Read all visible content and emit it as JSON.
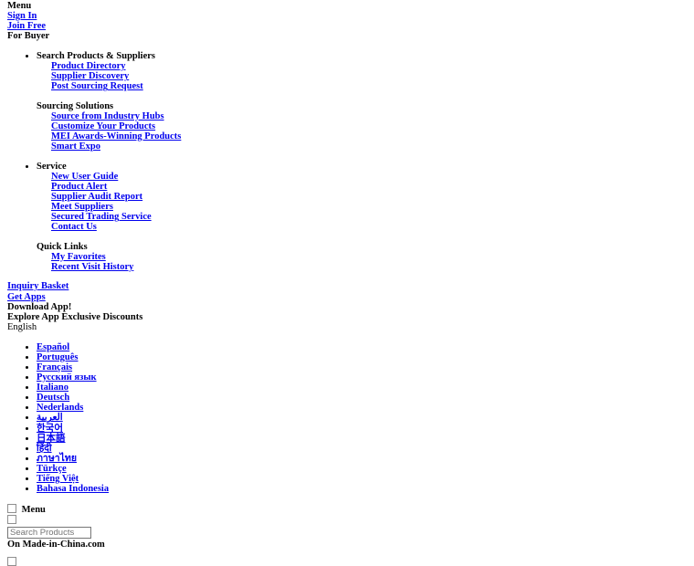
{
  "top": {
    "menu_label": "Menu",
    "sign_in": "Sign In",
    "join_free": "Join Free",
    "for_buyer": "For Buyer"
  },
  "nav": {
    "groups": [
      {
        "title": "Search Products & Suppliers",
        "bulleted": true,
        "links": [
          "Product Directory",
          "Supplier Discovery",
          "Post Sourcing Request"
        ]
      },
      {
        "title": "Sourcing Solutions",
        "bulleted": false,
        "links": [
          "Source from Industry Hubs",
          "Customize Your Products",
          "MEI Awards-Winning Products",
          "Smart Expo"
        ]
      },
      {
        "title": "Service",
        "bulleted": true,
        "links": [
          "New User Guide",
          "Product Alert",
          "Supplier Audit Report",
          "Meet Suppliers",
          "Secured Trading Service",
          "Contact Us"
        ]
      },
      {
        "title": "Quick Links",
        "bulleted": false,
        "links": [
          "My Favorites",
          "Recent Visit History"
        ]
      }
    ]
  },
  "utility": {
    "inquiry_basket": "Inquiry Basket",
    "get_apps": "Get Apps",
    "download_app": "Download App!",
    "explore_discounts": "Explore App Exclusive Discounts",
    "current_language": "English"
  },
  "languages": [
    "Español",
    "Português",
    "Français",
    "Русский язык",
    "Italiano",
    "Deutsch",
    "Nederlands",
    "العربية",
    "한국어",
    "日本語",
    "हिंदी",
    "ภาษาไทย",
    "Türkçe",
    "Tiếng Việt",
    "Bahasa Indonesia"
  ],
  "bottom": {
    "menu_toggle_label": "Menu",
    "search_placeholder": "Search Products",
    "search_value": "",
    "scope_label": "On Made-in-China.com"
  },
  "colors": {
    "link": "#0000EE",
    "visited_link": "#551A8B",
    "text": "#000000",
    "background": "#FFFFFF",
    "input_border": "#767676",
    "placeholder": "#757575"
  }
}
